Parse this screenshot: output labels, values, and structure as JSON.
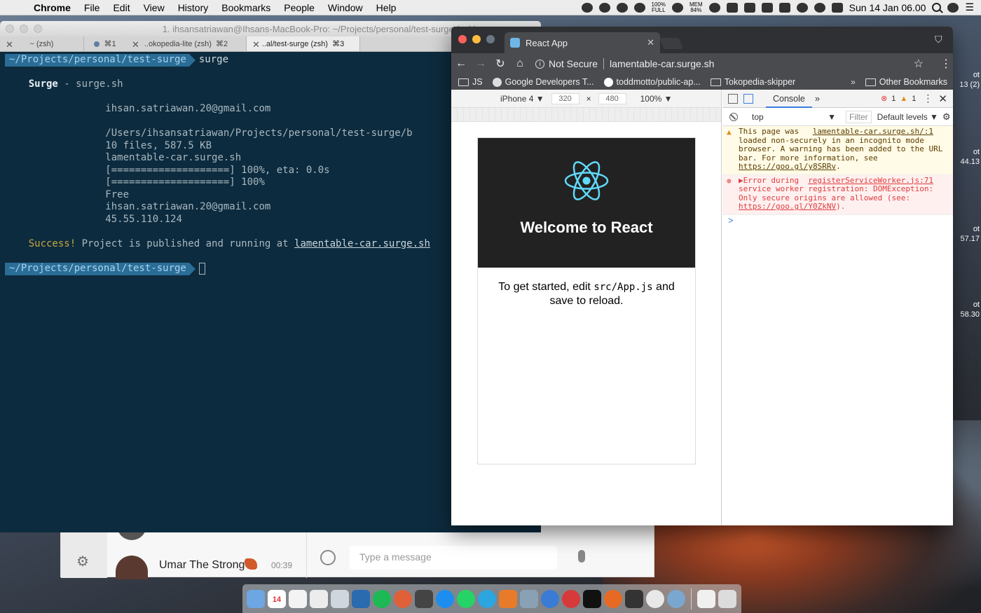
{
  "menubar": {
    "app": "Chrome",
    "items": [
      "File",
      "Edit",
      "View",
      "History",
      "Bookmarks",
      "People",
      "Window",
      "Help"
    ],
    "battery_top": "100%",
    "battery_bottom": "FULL",
    "mem_top": "MEM",
    "mem_bottom": "84%",
    "clock": "Sun 14 Jan  06.00"
  },
  "edge_text": [
    {
      "line1": "ot",
      "line2": "13 (2)"
    },
    {
      "line1": "ot",
      "line2": "44.13"
    },
    {
      "line1": "ot",
      "line2": "57.17"
    },
    {
      "line1": "ot",
      "line2": "58.30"
    }
  ],
  "terminal": {
    "title": "1. ihsansatriawan@Ihsans-MacBook-Pro: ~/Projects/personal/test-surge (zsh)",
    "tabs": [
      {
        "label": "~ (zsh)",
        "shortcut": ""
      },
      {
        "label": "⌘1",
        "shortcut": ""
      },
      {
        "label": "..okopedia-lite (zsh)",
        "shortcut": "⌘2"
      },
      {
        "label": "..al/test-surge (zsh)",
        "shortcut": "⌘3"
      }
    ],
    "prompt": "~/Projects/personal/test-surge",
    "command": "surge",
    "surge_title": "Surge",
    "surge_sub": " - surge.sh",
    "email": "ihsan.satriawan.20@gmail.com",
    "path": "/Users/ihsansatriawan/Projects/personal/test-surge/b",
    "files": "10 files, 587.5 KB",
    "domain": "lamentable-car.surge.sh",
    "progress1": "[====================] 100%, eta: 0.0s",
    "progress2": "[====================] 100%",
    "plan": "Free",
    "email2": "ihsan.satriawan.20@gmail.com",
    "ip": "45.55.110.124",
    "success_label": "Success!",
    "success_text": " Project is published and running at ",
    "success_url": "lamentable-car.surge.sh"
  },
  "chrome": {
    "tab_title": "React App",
    "security": "Not Secure",
    "url": "lamentable-car.surge.sh",
    "bookmarks": [
      "JS",
      "Google Developers T...",
      "toddmotto/public-ap...",
      "Tokopedia-skipper"
    ],
    "bookmarks_more": "»",
    "other_bookmarks": "Other Bookmarks",
    "device": "iPhone 4 ▼",
    "width": "320",
    "height": "480",
    "zoom": "100% ▼",
    "page_title": "Welcome to React",
    "intro_before": "To get started, edit ",
    "intro_code": "src/App.js",
    "intro_after": " and save to reload."
  },
  "devtools": {
    "tab": "Console",
    "more": "»",
    "errors": "1",
    "warnings": "1",
    "context": "top",
    "filter": "Filter",
    "levels": "Default levels ▼",
    "warn_text": "This page was loaded non-securely in an incognito mode browser. A warning has been added to the URL bar. For more information, see ",
    "warn_link": "https://goo.gl/y8SRRv",
    "warn_src": "lamentable-car.surge.sh/:1",
    "err_text": "▶Error during service worker registration: DOMException: Only secure origins are allowed (see: ",
    "err_link": "https://goo.gl/Y0ZkNV",
    "err_src": "registerServiceWorker.js:71",
    "prompt_caret": ">"
  },
  "chat": {
    "contact": "Umar The Strong",
    "time": "00:39",
    "placeholder": "Type a message"
  },
  "dock": {
    "calendar_day": "14"
  },
  "colors": {
    "terminal_bg": "#0d2b3e",
    "prompt_bg": "#2a6d97",
    "react_header": "#222222",
    "react_blue": "#61dafb",
    "error": "#e03b3b",
    "warning": "#e08c1b"
  }
}
